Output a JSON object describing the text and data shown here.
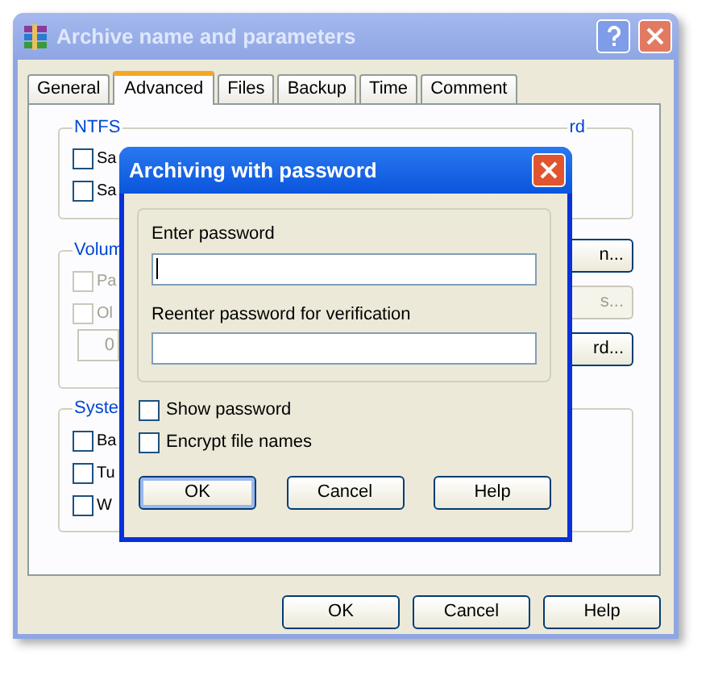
{
  "window": {
    "title": "Archive name and parameters",
    "active": false
  },
  "tabs": [
    {
      "label": "General",
      "selected": false
    },
    {
      "label": "Advanced",
      "selected": true
    },
    {
      "label": "Files",
      "selected": false
    },
    {
      "label": "Backup",
      "selected": false
    },
    {
      "label": "Time",
      "selected": false
    },
    {
      "label": "Comment",
      "selected": false
    }
  ],
  "ntfs_group": {
    "label": "NTFS",
    "checkboxes": [
      {
        "label": "Sa",
        "checked": false,
        "disabled": false
      },
      {
        "label": "Sa",
        "checked": false,
        "disabled": false
      }
    ]
  },
  "recovery_group": {
    "label": "rd"
  },
  "volume_group": {
    "label": "Volum",
    "checkboxes": [
      {
        "label": "Pa",
        "checked": false,
        "disabled": true
      },
      {
        "label": "Ol",
        "checked": false,
        "disabled": true
      }
    ],
    "field": {
      "value": "0",
      "disabled": true
    }
  },
  "side_buttons": [
    {
      "label": "n...",
      "disabled": false
    },
    {
      "label": "s...",
      "disabled": true
    },
    {
      "label": "rd...",
      "disabled": false
    }
  ],
  "system_group": {
    "label": "Syste",
    "checkboxes": [
      {
        "label": "Ba",
        "checked": false,
        "disabled": false
      },
      {
        "label": "Tu",
        "checked": false,
        "disabled": false
      },
      {
        "label": "W",
        "checked": false,
        "disabled": false
      }
    ]
  },
  "buttons": [
    {
      "label": "OK",
      "default": false
    },
    {
      "label": "Cancel",
      "default": false
    },
    {
      "label": "Help",
      "default": false
    }
  ],
  "password_dialog": {
    "title": "Archiving with password",
    "active": true,
    "fields": [
      {
        "label": "Enter password",
        "focused": true
      },
      {
        "label": "Reenter password for verification",
        "focused": false
      }
    ],
    "checkboxes": [
      {
        "label": "Show password",
        "checked": false
      },
      {
        "label": "Encrypt file names",
        "checked": false
      }
    ],
    "buttons": [
      {
        "label": "OK",
        "default": true
      },
      {
        "label": "Cancel",
        "default": false
      },
      {
        "label": "Help",
        "default": false
      }
    ]
  }
}
